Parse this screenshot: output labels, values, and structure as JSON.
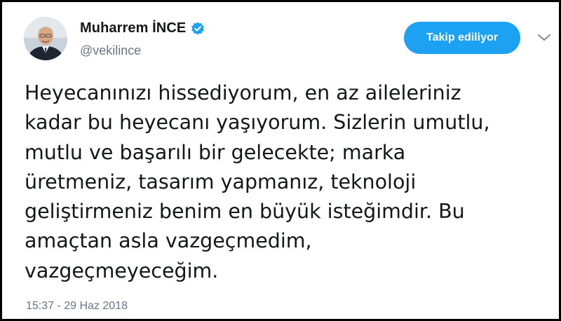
{
  "user": {
    "display_name": "Muharrem İNCE",
    "handle": "@vekilince",
    "verified": true,
    "avatar_icon": "profile-photo"
  },
  "follow_button": {
    "label": "Takip ediliyor"
  },
  "menu_icon": "chevron-down-icon",
  "tweet": {
    "lines": [
      "Heyecanınızı hissediyorum, en az aileleriniz",
      "kadar bu heyecanı yaşıyorum. Sizlerin umutlu,",
      "mutlu ve başarılı bir gelecekte; marka",
      "üretmeniz, tasarım yapmanız, teknoloji",
      "geliştirmeniz benim en büyük isteğimdir. Bu",
      "amaçtan asla vazgeçmedim,",
      "vazgeçmeyeceğim."
    ],
    "timestamp": "15:37 - 29 Haz 2018"
  },
  "colors": {
    "accent": "#1da1f2",
    "text": "#14171a",
    "muted": "#657786",
    "border": "#000000"
  }
}
